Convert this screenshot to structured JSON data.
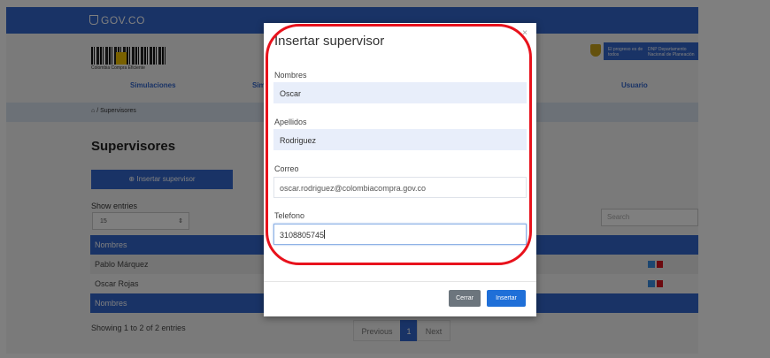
{
  "gov_bar": {
    "text": "GOV.CO"
  },
  "logo": {
    "caption": "Colombia Compra Eficiente"
  },
  "gov_logo": {
    "line1": "El progreso es de todos",
    "line2": "DNP Departamento Nacional de Planeación"
  },
  "nav": {
    "items": [
      "Simulaciones",
      "Sim",
      "Usuario"
    ]
  },
  "breadcrumb": "/ Supervisores",
  "page_title": "Supervisores",
  "insert_button": "Insertar supervisor",
  "show_entries": {
    "label": "Show entries",
    "value": "15"
  },
  "search": {
    "placeholder": "Search"
  },
  "table": {
    "header": "Nombres",
    "rows": [
      "Pablo Márquez",
      "Oscar Rojas"
    ],
    "footer": "Nombres"
  },
  "showing": "Showing 1 to 2 of 2 entries",
  "pager": {
    "previous": "Previous",
    "current": "1",
    "next": "Next"
  },
  "modal": {
    "title": "Insertar supervisor",
    "close": "×",
    "fields": [
      {
        "label": "Nombres",
        "value": "Oscar"
      },
      {
        "label": "Apellidos",
        "value": "Rodriguez"
      },
      {
        "label": "Correo",
        "value": "oscar.rodriguez@colombiacompra.gov.co"
      },
      {
        "label": "Telefono",
        "value": "3108805745"
      }
    ],
    "cerrar": "Cerrar",
    "insertar": "Insertar"
  },
  "colors": {
    "brand_blue": "#3366cc",
    "highlight_red": "#e8121c"
  }
}
